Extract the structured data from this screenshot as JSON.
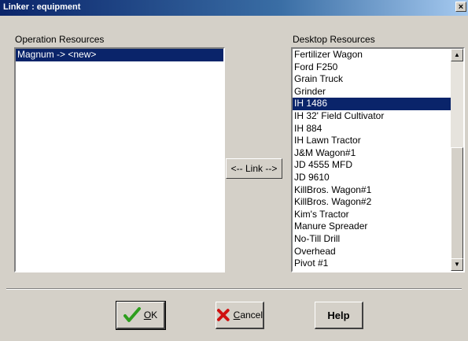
{
  "window": {
    "title": "Linker : equipment",
    "close_glyph": "×"
  },
  "operation": {
    "label": "Operation Resources",
    "items": [
      {
        "text": "Magnum -> <new>",
        "selected": true
      }
    ]
  },
  "desktop": {
    "label": "Desktop Resources",
    "items": [
      {
        "text": "Fertilizer Wagon",
        "selected": false
      },
      {
        "text": "Ford F250",
        "selected": false
      },
      {
        "text": "Grain Truck",
        "selected": false
      },
      {
        "text": "Grinder",
        "selected": false
      },
      {
        "text": "IH 1486",
        "selected": true
      },
      {
        "text": "IH 32' Field Cultivator",
        "selected": false
      },
      {
        "text": "IH 884",
        "selected": false
      },
      {
        "text": "IH Lawn Tractor",
        "selected": false
      },
      {
        "text": "J&M Wagon#1",
        "selected": false
      },
      {
        "text": "JD 4555 MFD",
        "selected": false
      },
      {
        "text": "JD 9610",
        "selected": false
      },
      {
        "text": "KillBros. Wagon#1",
        "selected": false
      },
      {
        "text": "KillBros. Wagon#2",
        "selected": false
      },
      {
        "text": "Kim's Tractor",
        "selected": false
      },
      {
        "text": "Manure Spreader",
        "selected": false
      },
      {
        "text": "No-Till Drill",
        "selected": false
      },
      {
        "text": "Overhead",
        "selected": false
      },
      {
        "text": "Pivot #1",
        "selected": false
      }
    ],
    "scroll_up_glyph": "▲",
    "scroll_down_glyph": "▼"
  },
  "link_button": {
    "label": "<-- Link -->"
  },
  "buttons": {
    "ok": {
      "mnemonic": "O",
      "rest": "K",
      "icon": "check-icon"
    },
    "cancel": {
      "mnemonic": "C",
      "rest": "ancel",
      "icon": "x-icon"
    },
    "help": {
      "label": "Help"
    }
  },
  "colors": {
    "selection": "#0a246a",
    "check": "#2e9e1e",
    "x_red": "#d01010"
  }
}
